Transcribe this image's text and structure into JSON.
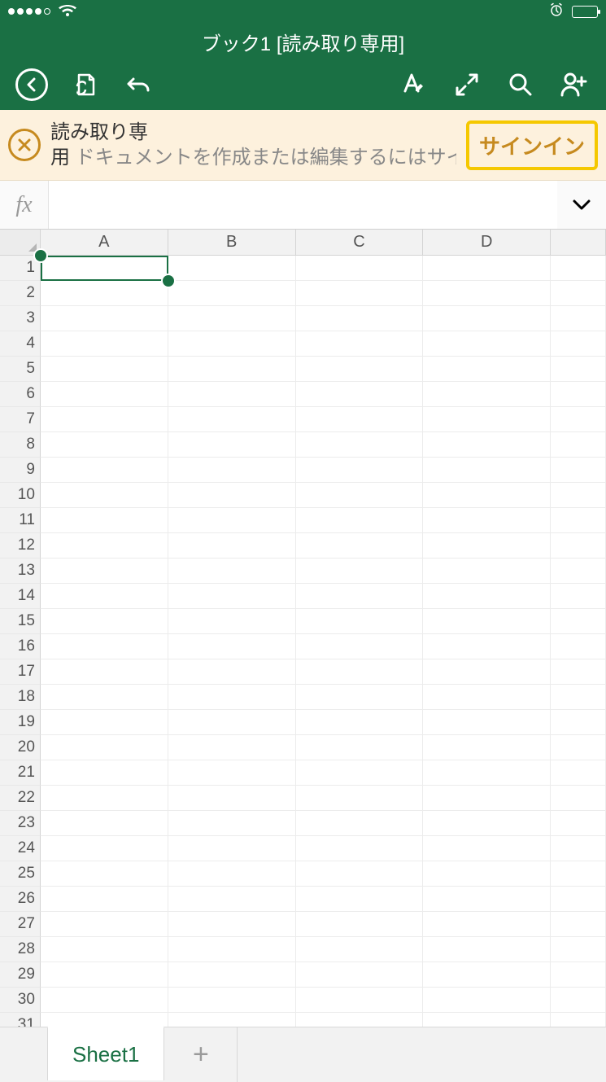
{
  "status": {
    "signal_dots": 5,
    "signal_filled": 4
  },
  "title": "ブック1 [読み取り専用]",
  "banner": {
    "strong": "読み取り専用",
    "body": "ドキュメントを作成または編集するにはサインインし…",
    "button": "サインイン"
  },
  "formula": {
    "fx": "fx",
    "value": ""
  },
  "grid": {
    "columns": [
      "A",
      "B",
      "C",
      "D",
      ""
    ],
    "row_count": 31,
    "selected_cell": "A1"
  },
  "sheet": {
    "active": "Sheet1"
  }
}
